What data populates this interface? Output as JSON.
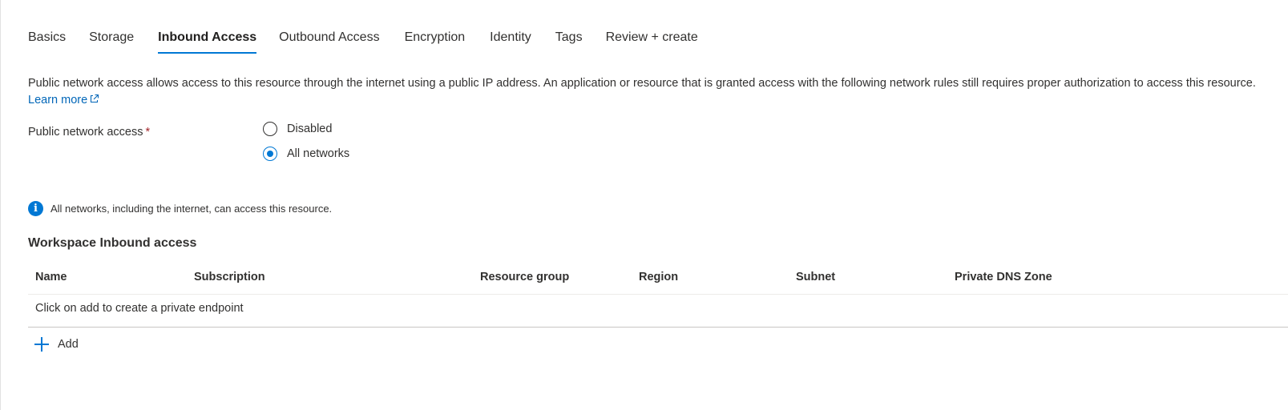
{
  "tabs": [
    {
      "label": "Basics",
      "active": false
    },
    {
      "label": "Storage",
      "active": false
    },
    {
      "label": "Inbound Access",
      "active": true
    },
    {
      "label": "Outbound Access",
      "active": false
    },
    {
      "label": "Encryption",
      "active": false
    },
    {
      "label": "Identity",
      "active": false
    },
    {
      "label": "Tags",
      "active": false
    },
    {
      "label": "Review + create",
      "active": false
    }
  ],
  "description": {
    "text": "Public network access allows access to this resource through the internet using a public IP address. An application or resource that is granted access with the following network rules still requires proper authorization to access this resource.",
    "link_label": "Learn more",
    "link_icon": "external-link-icon"
  },
  "public_network_access": {
    "label": "Public network access",
    "required_marker": "*",
    "options": [
      {
        "label": "Disabled",
        "selected": false
      },
      {
        "label": "All networks",
        "selected": true
      }
    ]
  },
  "info": {
    "icon": "info-icon",
    "text": "All networks, including the internet, can access this resource."
  },
  "workspace_inbound": {
    "title": "Workspace Inbound access",
    "columns": [
      "Name",
      "Subscription",
      "Resource group",
      "Region",
      "Subnet",
      "Private DNS Zone"
    ],
    "empty_row": "Click on add to create a private endpoint",
    "add_label": "Add",
    "add_icon": "plus-icon"
  },
  "colors": {
    "accent": "#0078d4",
    "link": "#0066b8",
    "required": "#a4262c"
  }
}
